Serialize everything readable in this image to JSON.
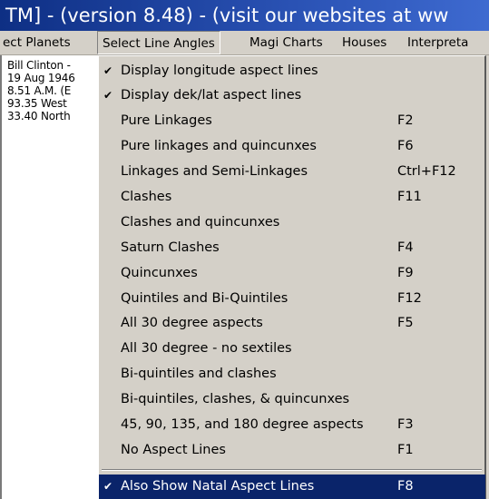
{
  "window": {
    "title": "TM] - (version 8.48) - (visit our websites at ww"
  },
  "menu_bar": {
    "items": [
      {
        "label": "ect Planets"
      },
      {
        "label": "Select Line Angles"
      },
      {
        "label": "Magi Charts"
      },
      {
        "label": "Houses"
      },
      {
        "label": "Interpreta"
      }
    ]
  },
  "chart_info": {
    "lines": [
      "Bill Clinton -",
      "19 Aug 1946",
      "8.51 A.M. (E",
      "93.35 West",
      "33.40 North"
    ]
  },
  "dropdown": {
    "items": [
      {
        "label": "Display longitude aspect lines",
        "accelerator": "",
        "checked": "✔"
      },
      {
        "label": "Display dek/lat aspect lines",
        "accelerator": "",
        "checked": "✔"
      },
      {
        "label": "Pure Linkages",
        "accelerator": "F2",
        "checked": ""
      },
      {
        "label": "Pure linkages and quincunxes",
        "accelerator": "F6",
        "checked": ""
      },
      {
        "label": "Linkages and Semi-Linkages",
        "accelerator": "Ctrl+F12",
        "checked": ""
      },
      {
        "label": "Clashes",
        "accelerator": "F11",
        "checked": ""
      },
      {
        "label": "Clashes and quincunxes",
        "accelerator": "",
        "checked": ""
      },
      {
        "label": "Saturn Clashes",
        "accelerator": "F4",
        "checked": ""
      },
      {
        "label": "Quincunxes",
        "accelerator": "F9",
        "checked": ""
      },
      {
        "label": "Quintiles and Bi-Quintiles",
        "accelerator": "F12",
        "checked": ""
      },
      {
        "label": "All 30 degree aspects",
        "accelerator": "F5",
        "checked": ""
      },
      {
        "label": "All 30 degree - no sextiles",
        "accelerator": "",
        "checked": ""
      },
      {
        "label": "Bi-quintiles and clashes",
        "accelerator": "",
        "checked": ""
      },
      {
        "label": "Bi-quintiles, clashes, & quincunxes",
        "accelerator": "",
        "checked": ""
      },
      {
        "label": "45, 90, 135, and 180 degree aspects",
        "accelerator": "F3",
        "checked": ""
      },
      {
        "label": "No Aspect Lines",
        "accelerator": "F1",
        "checked": ""
      }
    ],
    "footer_item": {
      "label": "Also Show Natal Aspect Lines",
      "accelerator": "F8",
      "checked": "✔"
    }
  },
  "colors": {
    "title_bar": "#1a3d8f",
    "menu_background": "#d4d0c8",
    "highlight": "#0a246a"
  }
}
